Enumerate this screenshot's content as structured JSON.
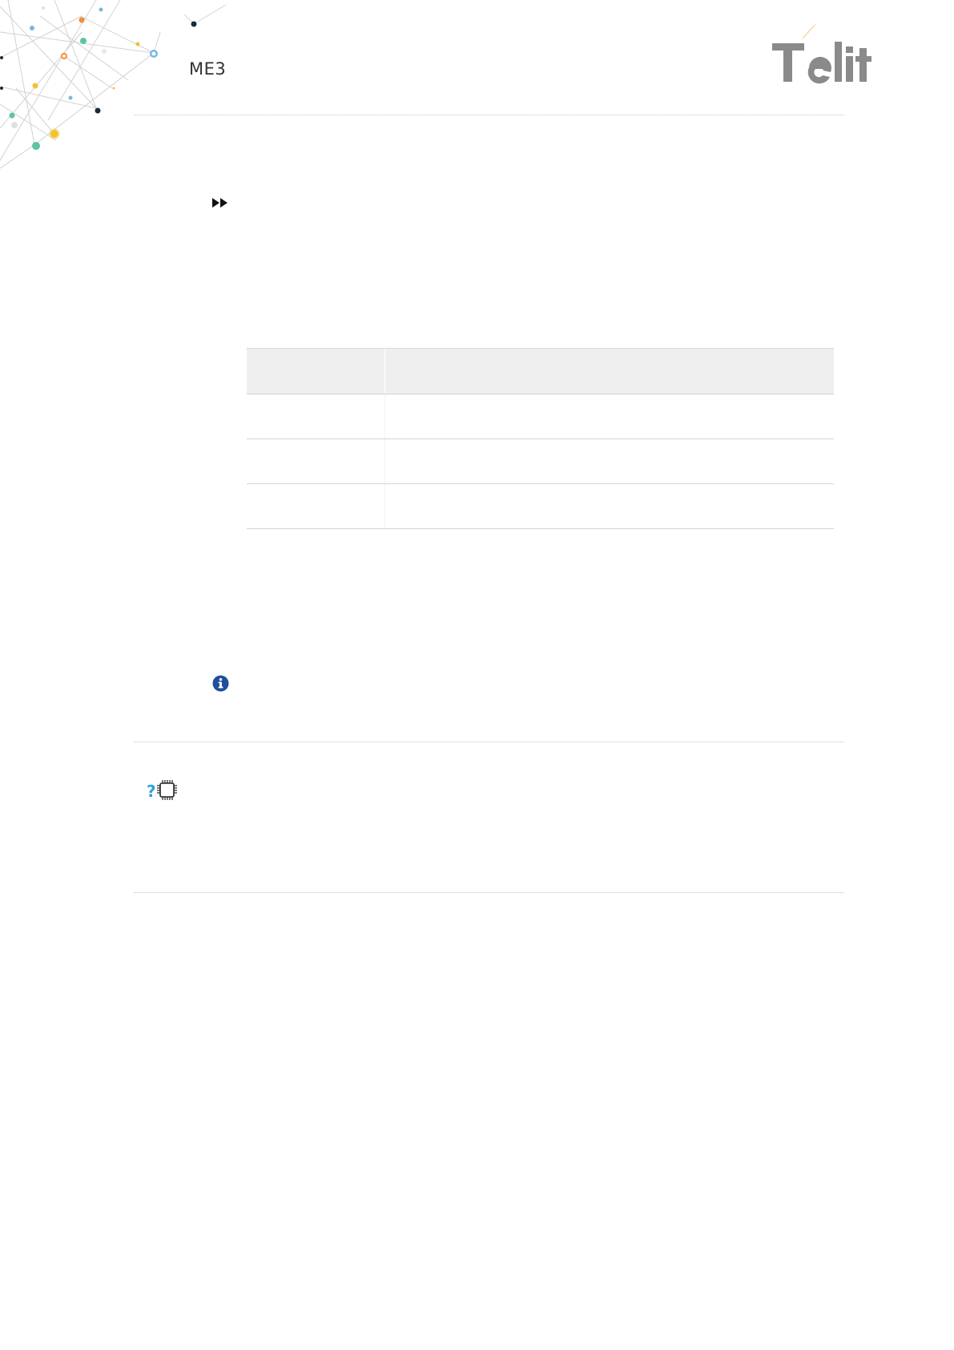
{
  "header": {
    "doc_code": "ME3",
    "logo_text": "Telit"
  },
  "icons": {
    "note_icon": "fast-forward-icon",
    "info_icon": "info-icon",
    "help_icon": "question-chip-icon"
  },
  "colors": {
    "logo_grey": "#8a8a8a",
    "logo_accent": "#f2a93b",
    "info_blue": "#1f4f9c",
    "help_blue": "#2aa3dc",
    "rule": "#c4c4c4",
    "table_header_bg": "#efefef"
  },
  "table": {
    "columns": [
      "",
      ""
    ],
    "rows": [
      [
        "",
        ""
      ],
      [
        "",
        ""
      ],
      [
        "",
        ""
      ]
    ]
  }
}
